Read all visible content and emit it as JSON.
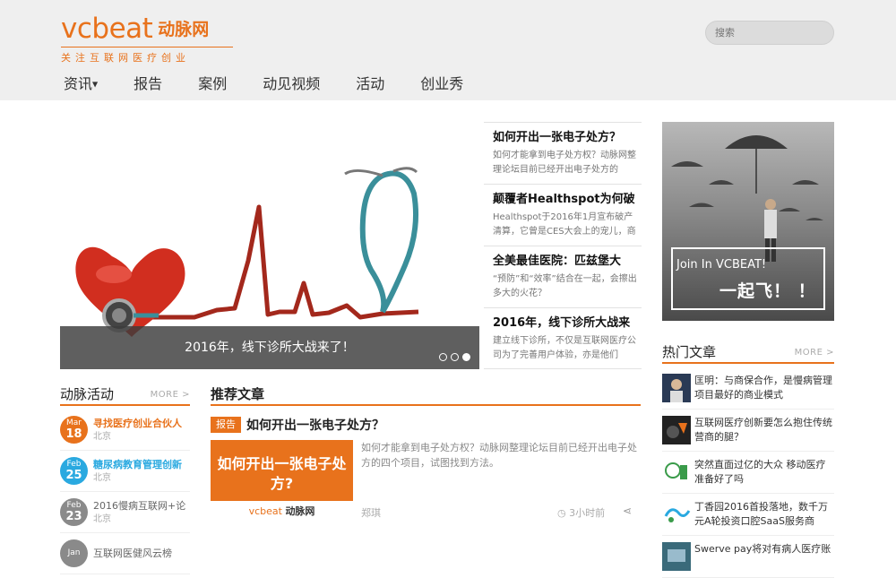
{
  "header": {
    "logo_text": "vcbeat",
    "logo_cn": "动脉网",
    "logo_tagline": "关注互联网医疗创业",
    "search_placeholder": "搜索"
  },
  "nav": [
    {
      "label": "资讯",
      "has_dropdown": true
    },
    {
      "label": "报告"
    },
    {
      "label": "案例"
    },
    {
      "label": "动见视频"
    },
    {
      "label": "活动"
    },
    {
      "label": "创业秀"
    }
  ],
  "slider": {
    "caption": "2016年，线下诊所大战来了！",
    "dot_count": 3,
    "active_dot": 2
  },
  "side_news": [
    {
      "title": "如何开出一张电子处方？",
      "desc": "如何才能拿到电子处方权？动脉网整理论坛目前已经开出电子处方的"
    },
    {
      "title": "颠覆者Healthspot为何破",
      "desc": "Healthspot于2016年1月宣布破产清算，它曾是CES大会上的宠儿，商"
    },
    {
      "title": "全美最佳医院：匹兹堡大",
      "desc": "“预防”和“效率”结合在一起，会擦出多大的火花？"
    },
    {
      "title": "2016年，线下诊所大战来",
      "desc": "建立线下诊所，不仅是互联网医疗公司为了完善用户体验，亦是他们"
    }
  ],
  "ad": {
    "line1": "Join In VCBEAT!",
    "line2": "一起飞！ ！"
  },
  "hot": {
    "title": "热门文章",
    "more": "MORE >",
    "items": [
      "匡明：与商保合作，是慢病管理项目最好的商业模式",
      "互联网医疗创新要怎么抱住传统营商的腿？",
      "突然直面过亿的大众 移动医疗准备好了吗",
      "丁香园2016首投落地，数千万元A轮投资口腔SaaS服务商",
      "Swerve pay将对有病人医疗账"
    ]
  },
  "events": {
    "title": "动脉活动",
    "more": "MORE >",
    "items": [
      {
        "mon": "Mar",
        "day": "18",
        "title": "寻找医疗创业合伙人",
        "loc": "北京",
        "color": "#e8721c"
      },
      {
        "mon": "Feb",
        "day": "25",
        "title": "糖尿病教育管理创新",
        "loc": "北京",
        "color": "#2aa9e0"
      },
      {
        "mon": "Feb",
        "day": "23",
        "title": "2016慢病互联网+论",
        "loc": "北京",
        "color": "#8a8a8a"
      },
      {
        "mon": "Jan",
        "day": "",
        "title": "互联网医健风云榜",
        "loc": "",
        "color": "#8a8a8a"
      }
    ]
  },
  "recommend": {
    "section_title": "推荐文章",
    "tag": "报告",
    "title": "如何开出一张电子处方？",
    "img_text": "如何开出一张电子处方?",
    "img_logo_en": "vcbeat",
    "img_logo_cn": "动脉网",
    "desc": "如何才能拿到电子处方权？动脉网整理论坛目前已经开出电子处方的四个项目，试图找到方法。",
    "author": "郑琪",
    "time": "3小时前"
  }
}
